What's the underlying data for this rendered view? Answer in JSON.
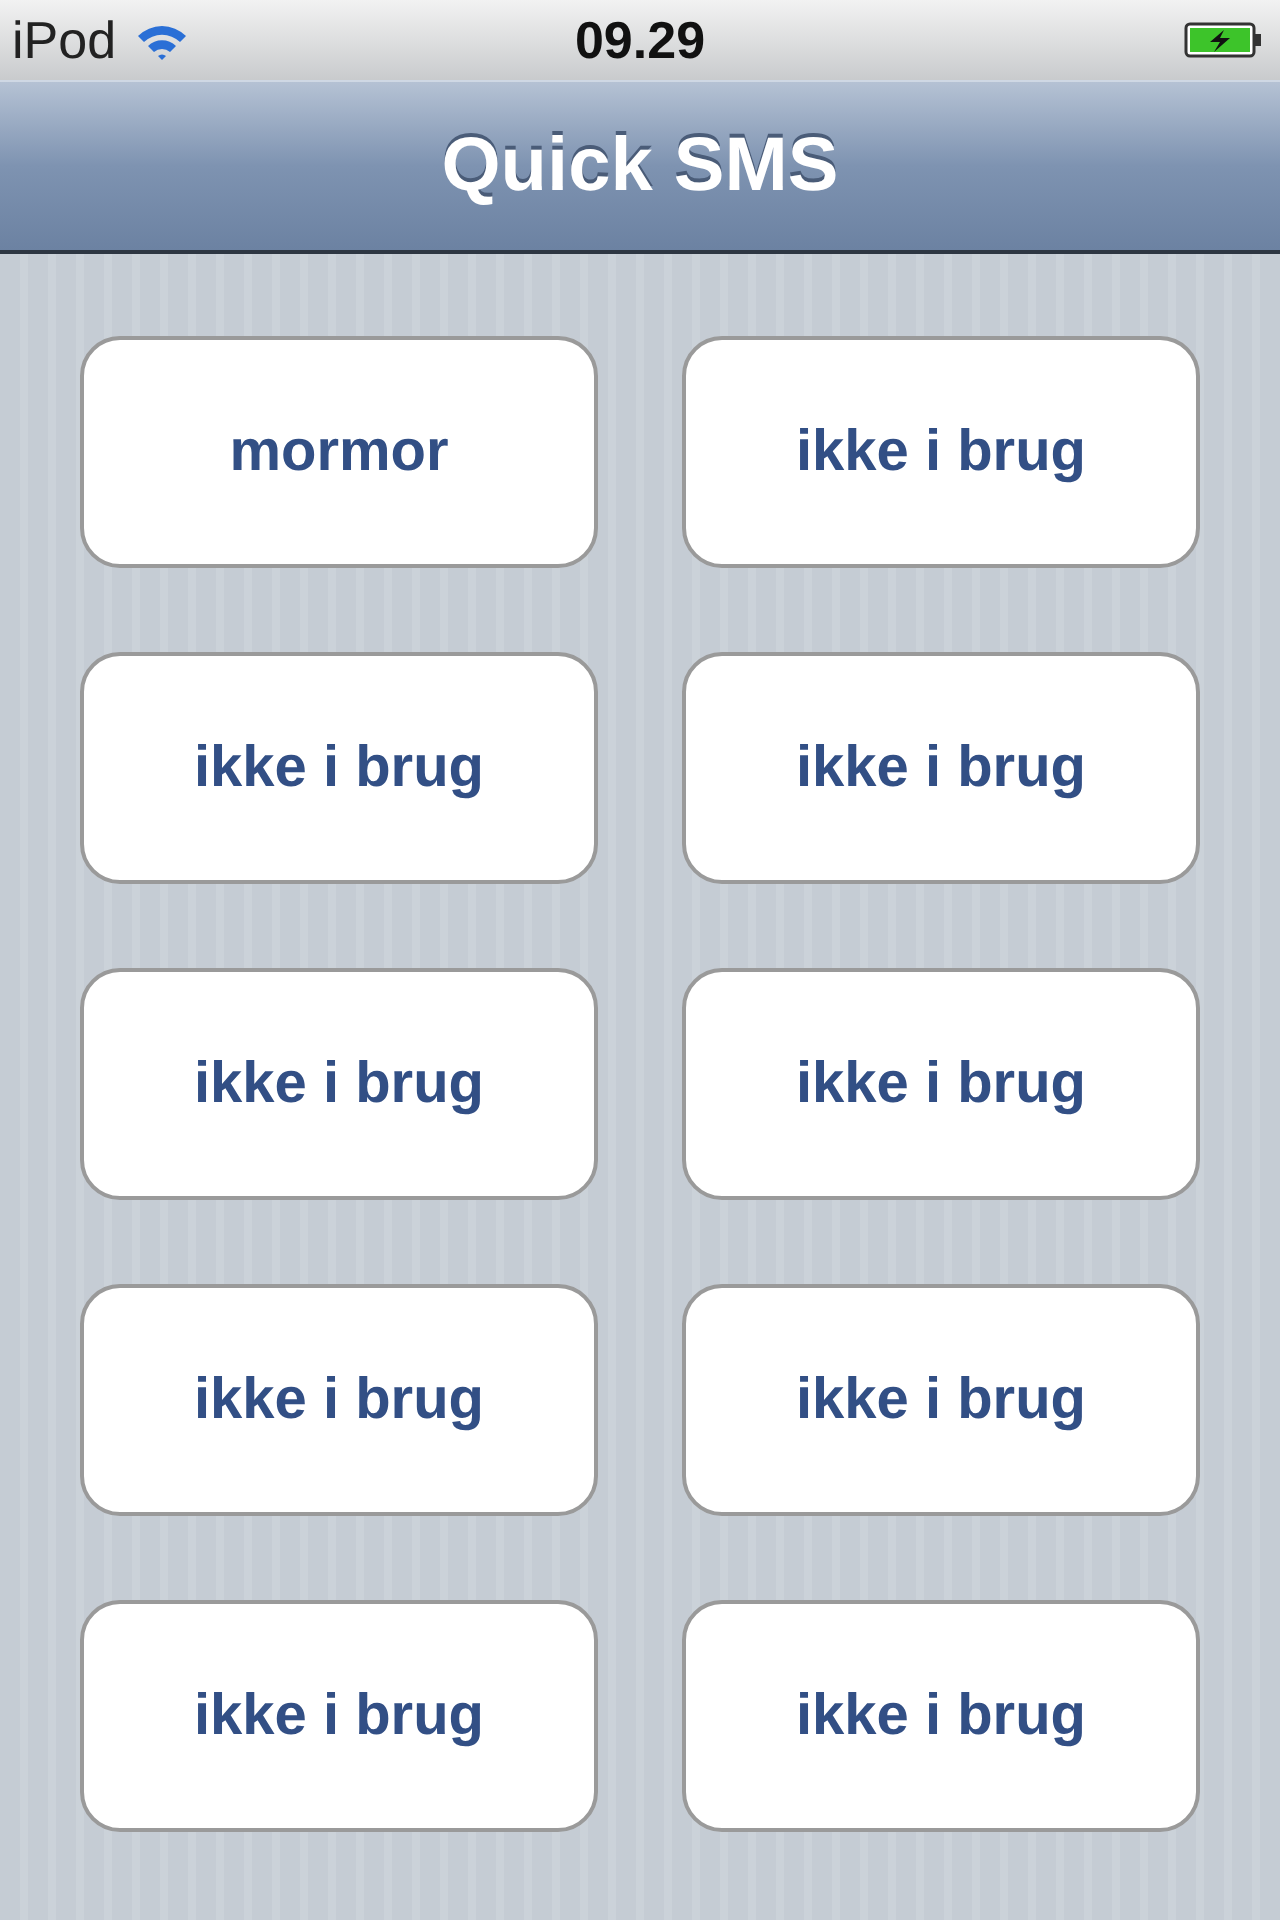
{
  "status_bar": {
    "carrier": "iPod",
    "time": "09.29"
  },
  "nav_bar": {
    "title": "Quick SMS"
  },
  "buttons": [
    {
      "label": "mormor"
    },
    {
      "label": "ikke i brug"
    },
    {
      "label": "ikke i brug"
    },
    {
      "label": "ikke i brug"
    },
    {
      "label": "ikke i brug"
    },
    {
      "label": "ikke i brug"
    },
    {
      "label": "ikke i brug"
    },
    {
      "label": "ikke i brug"
    },
    {
      "label": "ikke i brug"
    },
    {
      "label": "ikke i brug"
    }
  ]
}
